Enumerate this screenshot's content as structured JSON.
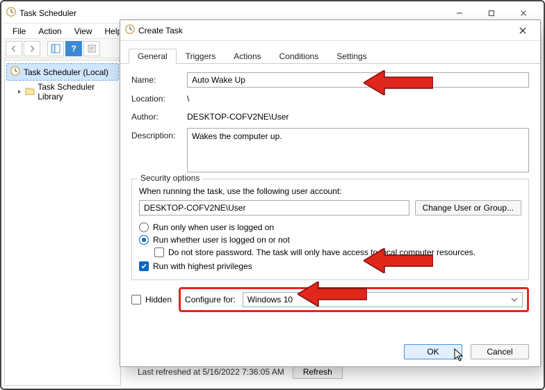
{
  "ts_window": {
    "title": "Task Scheduler",
    "menu": {
      "file": "File",
      "action": "Action",
      "view": "View",
      "help": "Help"
    },
    "tree": {
      "root": "Task Scheduler (Local)",
      "child": "Task Scheduler Library"
    },
    "status": {
      "text": "Last refreshed at 5/16/2022 7:36:05 AM",
      "refresh": "Refresh"
    }
  },
  "dialog": {
    "title": "Create Task",
    "tabs": {
      "general": "General",
      "triggers": "Triggers",
      "actions": "Actions",
      "conditions": "Conditions",
      "settings": "Settings"
    },
    "labels": {
      "name": "Name:",
      "location": "Location:",
      "author": "Author:",
      "description": "Description:",
      "security": "Security options",
      "acct_prompt": "When running the task, use the following user account:",
      "change_user": "Change User or Group...",
      "run_logged_on": "Run only when user is logged on",
      "run_whether": "Run whether user is logged on or not",
      "no_store_pw": "Do not store password.  The task will only have access to local computer resources.",
      "highest_priv": "Run with highest privileges",
      "hidden": "Hidden",
      "configure_for": "Configure for:",
      "ok": "OK",
      "cancel": "Cancel"
    },
    "values": {
      "name": "Auto Wake Up",
      "location": "\\",
      "author": "DESKTOP-COFV2NE\\User",
      "description": "Wakes the computer up.",
      "account": "DESKTOP-COFV2NE\\User",
      "configure_for": "Windows 10"
    },
    "state": {
      "run_logged_on_selected": false,
      "run_whether_selected": true,
      "no_store_pw_checked": false,
      "highest_priv_checked": true,
      "hidden_checked": false
    }
  }
}
